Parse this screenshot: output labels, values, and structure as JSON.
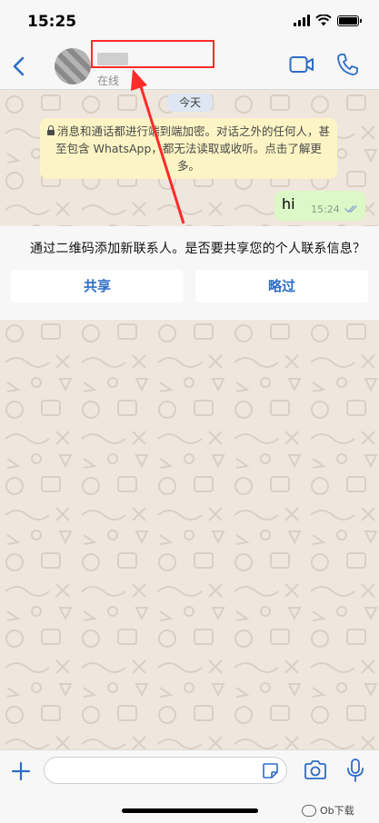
{
  "status_bar": {
    "time": "15:25"
  },
  "header": {
    "status": "在线"
  },
  "chat": {
    "date_label": "今天",
    "encryption_notice": "消息和通话都进行端到端加密。对话之外的任何人，甚至包含 WhatsApp，都无法读取或收听。点击了解更多。",
    "messages": [
      {
        "text": "hi",
        "time": "15:24"
      }
    ]
  },
  "share_banner": {
    "text": "通过二维码添加新联系人。是否要共享您的个人联系信息？",
    "share_label": "共享",
    "skip_label": "略过"
  },
  "composer": {
    "placeholder": ""
  },
  "watermark": {
    "text": "Ob下载"
  },
  "colors": {
    "accent": "#2d6cc6",
    "annotation": "#ff2a2a",
    "outgoing_bubble": "#dcf8c6",
    "notice_bg": "#fcf4c4"
  }
}
